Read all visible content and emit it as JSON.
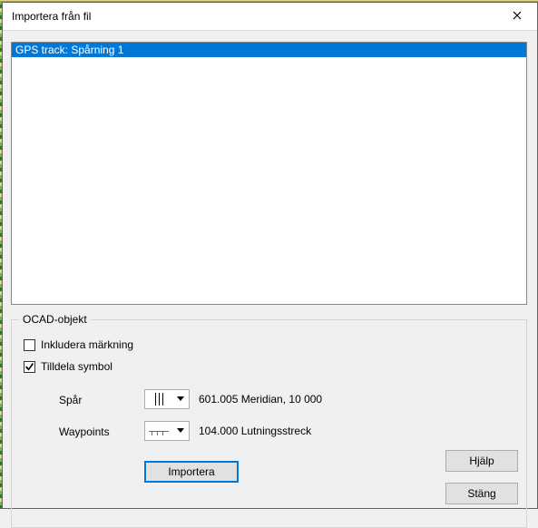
{
  "window": {
    "title": "Importera från fil"
  },
  "list": {
    "items": [
      {
        "label": "GPS track: Spårning 1",
        "selected": true
      }
    ]
  },
  "group": {
    "title": "OCAD-objekt",
    "include_marking": {
      "label": "Inkludera märkning",
      "checked": false
    },
    "assign_symbol": {
      "label": "Tilldela symbol",
      "checked": true
    },
    "rows": {
      "track": {
        "label": "Spår",
        "symbol_text": "601.005 Meridian, 10 000"
      },
      "waypoints": {
        "label": "Waypoints",
        "symbol_text": "104.000 Lutningsstreck"
      }
    }
  },
  "buttons": {
    "import": "Importera",
    "help": "Hjälp",
    "close": "Stäng"
  }
}
